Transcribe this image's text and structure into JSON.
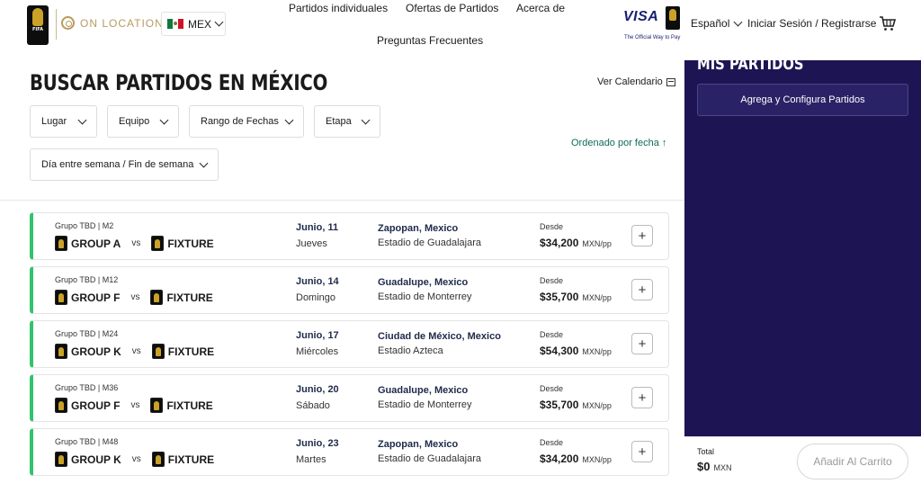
{
  "header": {
    "brand_label": "ON LOCATION",
    "fifa_logo_text": "FIFA",
    "country_code": "MEX",
    "nav": [
      "Partidos individuales",
      "Ofertas de Partidos",
      "Acerca de",
      "Preguntas Frecuentes"
    ],
    "visa_logo": "VISA",
    "visa_tagline": "The Official Way to Pay",
    "language": "Español",
    "login": "Iniciar Sesión / Registrarse",
    "cart_icon": "cart-icon"
  },
  "main": {
    "title": "BUSCAR PARTIDOS EN MÉXICO",
    "calendar_link": "Ver Calendario",
    "filters": [
      "Lugar",
      "Equipo",
      "Rango de Fechas",
      "Etapa",
      "Día entre semana / Fin de semana"
    ],
    "sort_label": "Ordenado por fecha ↑",
    "vs_label": "vs",
    "from_label": "Desde",
    "currency_label": "MXN/pp",
    "matches": [
      {
        "group": "Grupo TBD | M2",
        "team1": "GROUP A",
        "team2": "FIXTURE",
        "date": "Junio, 11",
        "day": "Jueves",
        "city": "Zapopan, Mexico",
        "venue": "Estadio de Guadalajara",
        "price": "$34,200"
      },
      {
        "group": "Grupo TBD | M12",
        "team1": "GROUP F",
        "team2": "FIXTURE",
        "date": "Junio, 14",
        "day": "Domingo",
        "city": "Guadalupe, Mexico",
        "venue": "Estadio de Monterrey",
        "price": "$35,700"
      },
      {
        "group": "Grupo TBD | M24",
        "team1": "GROUP K",
        "team2": "FIXTURE",
        "date": "Junio, 17",
        "day": "Miércoles",
        "city": "Ciudad de México, Mexico",
        "venue": "Estadio Azteca",
        "price": "$54,300"
      },
      {
        "group": "Grupo TBD | M36",
        "team1": "GROUP F",
        "team2": "FIXTURE",
        "date": "Junio, 20",
        "day": "Sábado",
        "city": "Guadalupe, Mexico",
        "venue": "Estadio de Monterrey",
        "price": "$35,700"
      },
      {
        "group": "Grupo TBD | M48",
        "team1": "GROUP K",
        "team2": "FIXTURE",
        "date": "Junio, 23",
        "day": "Martes",
        "city": "Zapopan, Mexico",
        "venue": "Estadio de Guadalajara",
        "price": "$34,200"
      }
    ]
  },
  "panel": {
    "title": "MIS PARTIDOS",
    "configure_button": "Agrega y Configura Partidos",
    "total_label": "Total",
    "total_value": "$0",
    "total_currency": "MXN",
    "add_to_cart": "Añadir Al Carrito"
  },
  "colors": {
    "panel_bg": "#1d1553",
    "accent_green": "#32c36c",
    "sort_link": "#0f6b5c",
    "gold": "#b89b5e"
  }
}
